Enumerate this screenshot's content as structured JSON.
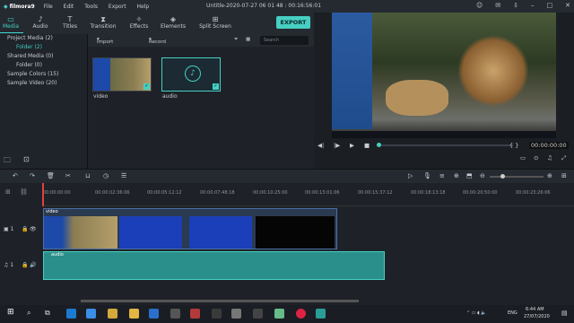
{
  "app": {
    "name": "filmora9",
    "window_title": "Untitle-2020-07-27 06 01 48 : 00:16:56:01",
    "menu": [
      "File",
      "Edit",
      "Tools",
      "Export",
      "Help"
    ]
  },
  "tabs": [
    {
      "label": "Media",
      "icon": "folder-icon"
    },
    {
      "label": "Audio",
      "icon": "music-icon"
    },
    {
      "label": "Titles",
      "icon": "text-icon"
    },
    {
      "label": "Transition",
      "icon": "transition-icon"
    },
    {
      "label": "Effects",
      "icon": "effects-icon"
    },
    {
      "label": "Elements",
      "icon": "elements-icon"
    },
    {
      "label": "Split Screen",
      "icon": "split-icon"
    }
  ],
  "export_label": "EXPORT",
  "library": [
    {
      "label": "Project Media (2)",
      "sub": false
    },
    {
      "label": "Folder (2)",
      "sub": true
    },
    {
      "label": "Shared Media (0)",
      "sub": false
    },
    {
      "label": "Folder (0)",
      "sub": true
    },
    {
      "label": "Sample Colors (15)",
      "sub": false
    },
    {
      "label": "Sample Video (20)",
      "sub": false
    }
  ],
  "mediabar": {
    "import": "Import",
    "record": "Record",
    "search_placeholder": "Search"
  },
  "media_items": [
    {
      "name": "video"
    },
    {
      "name": "audio"
    }
  ],
  "preview": {
    "timecode": "00:00:00:00",
    "ratio": "{ }"
  },
  "ruler": [
    "00:00:00:00",
    "00:00:02:36:06",
    "00:00:05:12:12",
    "00:00:07:48:18",
    "00:00:10:25:00",
    "00:00:13:01:06",
    "00:00:15:37:12",
    "00:00:18:13:18",
    "00:00:20:50:00",
    "00:00:23:26:06"
  ],
  "tracks": {
    "video_label": "1",
    "audio_label": "1",
    "video_clip": "video",
    "audio_clip": "audio"
  },
  "taskbar": {
    "time": "6:44 AM",
    "date": "27/07/2020",
    "lang": "ENG"
  },
  "colors": {
    "accent": "#46cfc2",
    "bg": "#1e2228"
  }
}
